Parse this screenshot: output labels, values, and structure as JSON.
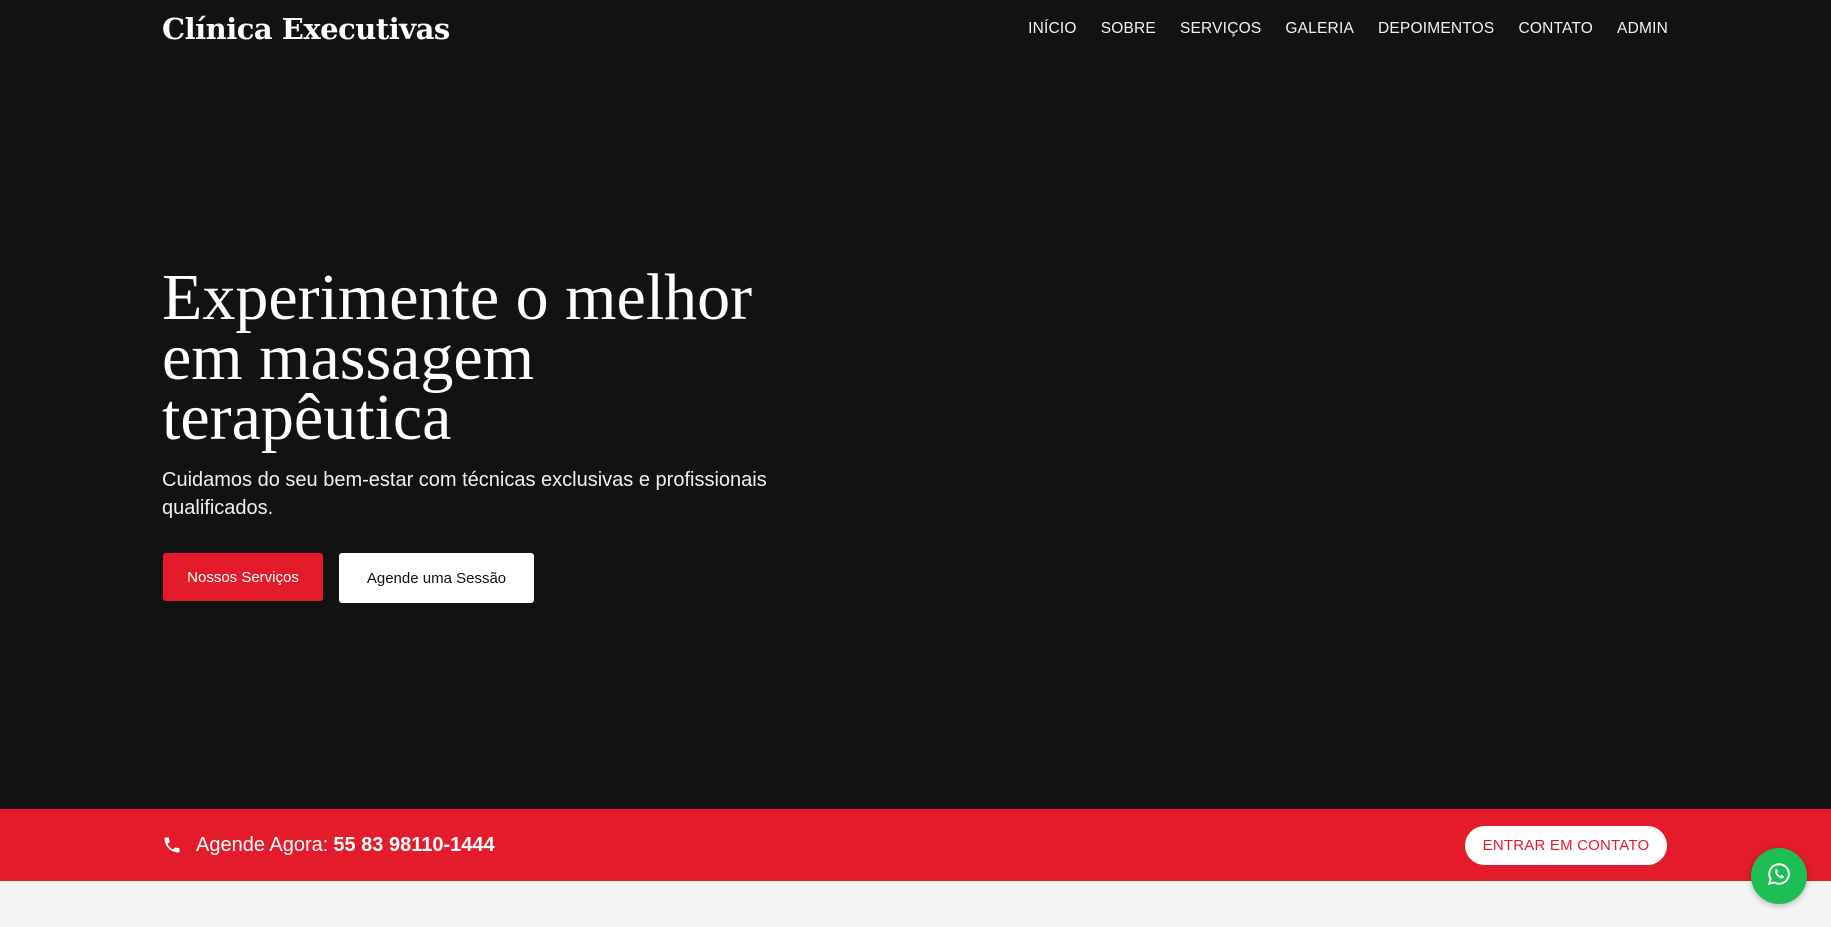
{
  "header": {
    "logo": "Clínica Executivas",
    "menu": [
      {
        "label": "INÍCIO"
      },
      {
        "label": "SOBRE"
      },
      {
        "label": "SERVIÇOS"
      },
      {
        "label": "GALERIA"
      },
      {
        "label": "DEPOIMENTOS"
      },
      {
        "label": "CONTATO"
      },
      {
        "label": "ADMIN"
      }
    ]
  },
  "hero": {
    "headline": "Experimente o melhor em massagem terapêutica",
    "subtitle": "Cuidamos do seu bem-estar com técnicas exclusivas e profissionais qualificados.",
    "primary_button": "Nossos Serviços",
    "secondary_button": "Agende uma Sessão"
  },
  "cta_bar": {
    "icon": "phone-icon",
    "label": "Agende Agora:",
    "phone": "55 83 98110-1444",
    "button": "ENTRAR EM CONTATO"
  },
  "floating": {
    "icon": "whatsapp-icon"
  },
  "colors": {
    "hero_bg": "#121212",
    "accent": "#e31b2b",
    "whatsapp": "#1dbf55",
    "page_bg": "#f4f4f4"
  }
}
